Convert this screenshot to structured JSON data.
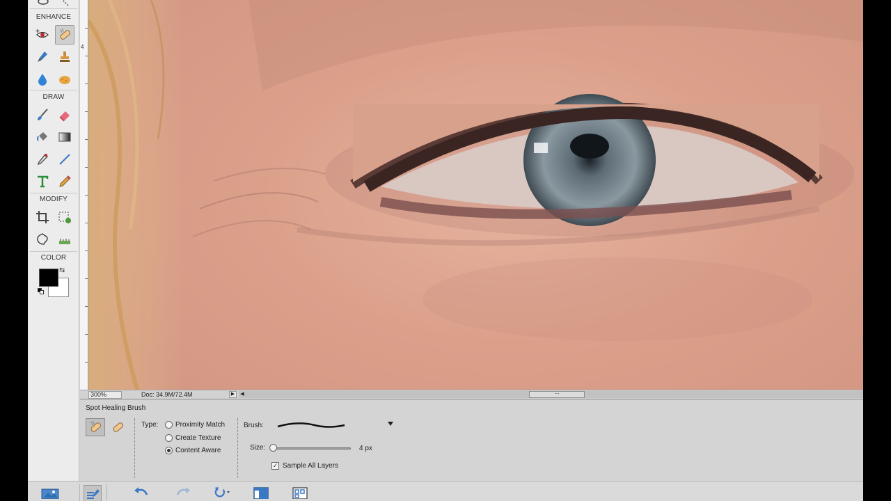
{
  "toolbox": {
    "enhance_label": "ENHANCE",
    "draw_label": "DRAW",
    "modify_label": "MODIFY",
    "color_label": "COLOR",
    "tools": {
      "enhance": [
        "red-eye-removal-icon",
        "spot-healing-brush-icon",
        "smart-brush-icon",
        "clone-stamp-icon",
        "blur-icon",
        "sponge-icon"
      ],
      "draw": [
        "brush-icon",
        "eraser-icon",
        "paint-bucket-icon",
        "gradient-icon",
        "color-picker-icon",
        "line-icon",
        "type-icon",
        "pencil-icon"
      ],
      "modify": [
        "crop-icon",
        "recompose-icon",
        "content-aware-move-icon",
        "straighten-icon"
      ]
    },
    "foreground_color": "#000000",
    "background_color": "#ffffff"
  },
  "ruler": {
    "mark": "4"
  },
  "status_bar": {
    "zoom": "300%",
    "doc_info": "Doc: 34.9M/72.4M"
  },
  "tool_options": {
    "tool_name": "Spot Healing Brush",
    "type_label": "Type:",
    "type_options": [
      "Proximity Match",
      "Create Texture",
      "Content Aware"
    ],
    "type_selected": "Content Aware",
    "brush_label": "Brush:",
    "size_label": "Size:",
    "size_value": "4 px",
    "sample_all_layers_label": "Sample All Layers",
    "sample_all_layers_checked": true
  },
  "bottom_bar": {
    "items": [
      "photo-bin-icon",
      "tool-options-icon",
      "undo-icon",
      "redo-icon",
      "rotate-icon",
      "layout-icon",
      "organizer-icon"
    ]
  },
  "accent": "#3b78c4"
}
